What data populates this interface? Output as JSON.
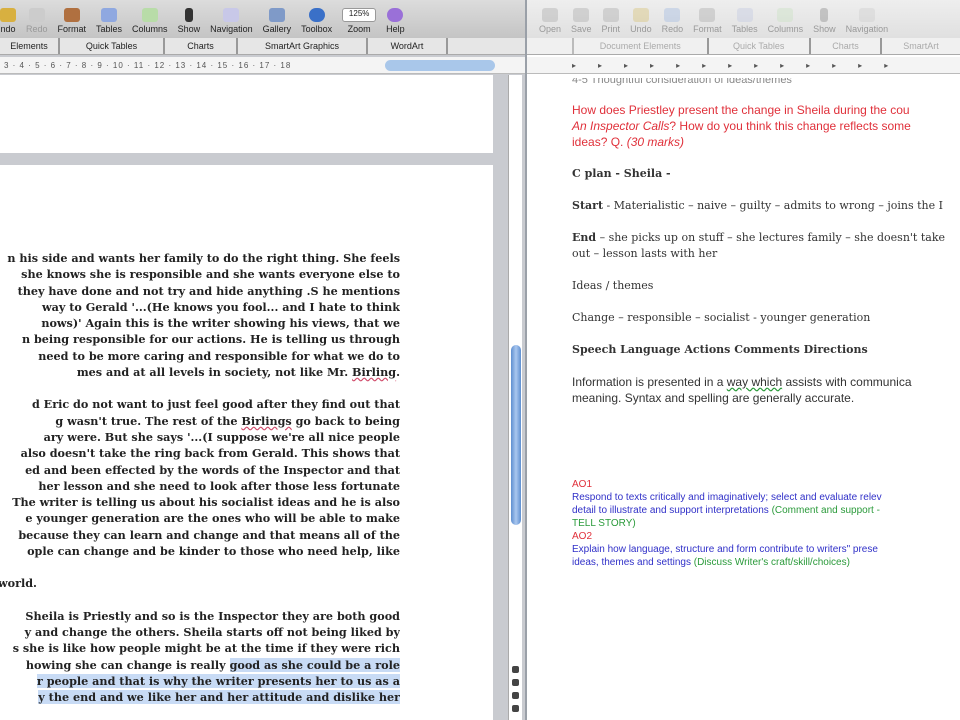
{
  "left_window": {
    "toolbar": [
      "ndo",
      "Redo",
      "Format",
      "Tables",
      "Columns",
      "Show",
      "Navigation",
      "Gallery",
      "Toolbox",
      "Zoom",
      "Help"
    ],
    "zoom_value": "125%",
    "ribbon_tabs": [
      "Elements",
      "Quick Tables",
      "Charts",
      "SmartArt Graphics",
      "WordArt"
    ],
    "ruler": "3 · 4 · 5 · 6 · 7 · 8 · 9 · 10 · 11 · 12 · 13 · 14 · 15 · 16 · 17 · 18",
    "para1": [
      "n his side and wants her family to do the right thing. She feels",
      "she knows she is responsible and she wants everyone else to",
      " they have done and not try and hide anything .S he mentions",
      "way to Gerald '...(He knows you fool... and I hate to think",
      "nows)' Again this is the writer showing his views, that we",
      "n being responsible for our actions. He is telling us through",
      " need to be more caring and responsible for what we do to",
      "mes and at all levels in society, not like Mr. ",
      "Birling",
      "."
    ],
    "para2": [
      "d Eric do not want to just feel good after they find out that",
      "g wasn't true. The rest of the ",
      "Birlings",
      " go back to being",
      "ary were. But she says '...(I suppose we're all nice people",
      " also doesn't take the ring back from Gerald. This shows that",
      "ed and been effected by the words of the Inspector and that",
      " her lesson and she need to look after those less fortunate",
      "The writer is telling us about his socialist ideas and he is also",
      "e younger generation are the ones who will be able to make",
      "because they can learn and change and that means all of the",
      "ople can change and be kinder to those who need help, like",
      " world."
    ],
    "para3": [
      "Sheila is Priestly and so is the Inspector they are both good",
      "y and change the others. Sheila starts off not being liked by",
      "s she is like how people might be at the time if they were rich",
      "howing she can change is really ",
      "good as she could be a role",
      "r people and that is why the writer presents her to us as a",
      "y the end and we like her and her attitude and dislike her"
    ]
  },
  "right_window": {
    "toolbar": [
      "Open",
      "Save",
      "Print",
      "Undo",
      "Redo",
      "Format",
      "Tables",
      "Columns",
      "Show",
      "Navigation"
    ],
    "ribbon_tabs": [
      "Document Elements",
      "Quick Tables",
      "Charts",
      "SmartArt"
    ],
    "faded_heading": "4-5 Thoughtful consideration of ideas/themes",
    "question": [
      "How does Priestley present the change in Sheila during the cou",
      "An Inspector Calls",
      "? How do you think this change reflects some",
      "ideas? Q. ",
      "(30 marks)"
    ],
    "plan_title": "C plan - Sheila -",
    "start_label": "Start",
    "start_text": " - Materialistic – naive – guilty – admits to wrong – joins the I",
    "end_label": "End",
    "end_text": " – she picks up on stuff – she lectures family – she doesn't take",
    "end_text2": "out – lesson lasts with her",
    "ideas": "Ideas / themes",
    "themes": "Change – responsible – socialist  - younger generation",
    "headings": "Speech Language Actions Comments Directions",
    "info": [
      "Information is presented in a ",
      "way which",
      " assists with communica",
      "meaning. Syntax and spelling are generally accurate."
    ],
    "ao1": "AO1",
    "ao1_text": [
      "Respond to texts critically and imaginatively; select and evaluate relev",
      "detail to illustrate and support interpretations ",
      "(Comment and support -",
      "TELL STORY)"
    ],
    "ao2": "AO2",
    "ao2_text": [
      "Explain how language, structure and form contribute to writers\" prese",
      "ideas, themes and settings ",
      "(Discuss Writer's craft/skill/choices)"
    ]
  },
  "colors": {
    "question": "#e0303a",
    "ao_label": "#e0303a",
    "ao_text": "#3030c8",
    "ao_note": "#2a9a3a",
    "scroll_thumb": "#5f8fd0"
  }
}
